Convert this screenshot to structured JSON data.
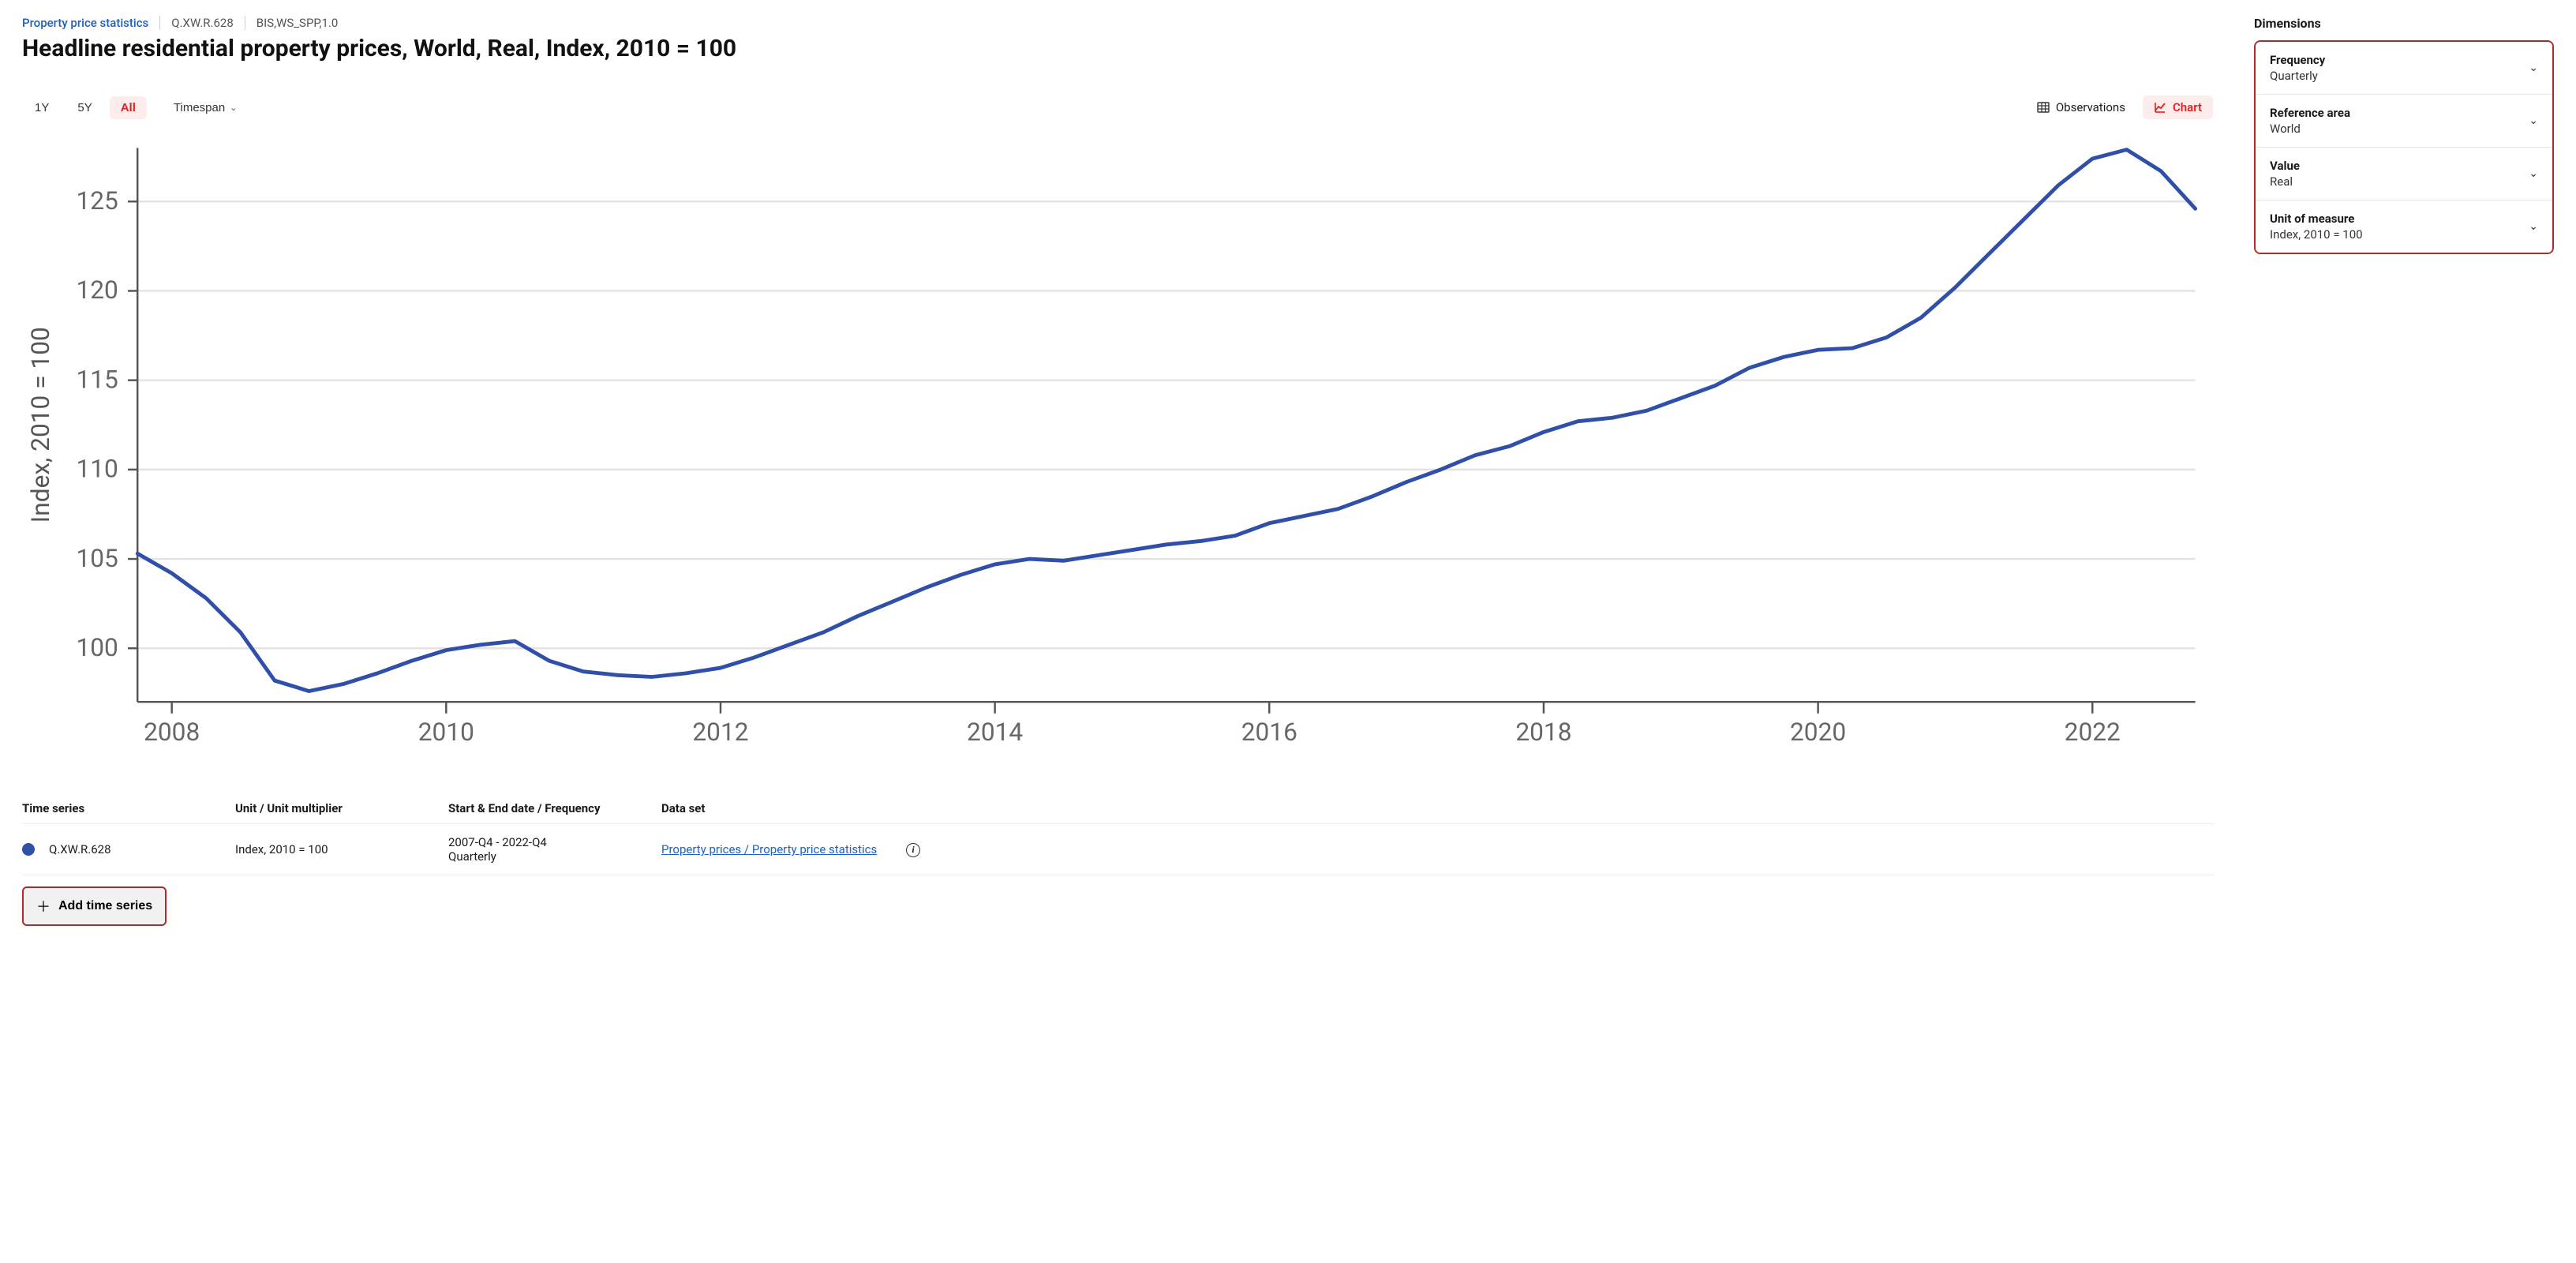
{
  "breadcrumb": {
    "dataset_link": "Property price statistics",
    "series_code": "Q.XW.R.628",
    "source_code": "BIS,WS_SPP,1.0"
  },
  "title": "Headline residential property prices, World, Real, Index, 2010 = 100",
  "controls": {
    "range_1y": "1Y",
    "range_5y": "5Y",
    "range_all": "All",
    "timespan": "Timespan",
    "observations": "Observations",
    "chart": "Chart"
  },
  "chart_data": {
    "type": "line",
    "title": "Headline residential property prices, World, Real, Index, 2010 = 100",
    "xlabel": "",
    "ylabel": "Index, 2010 = 100",
    "ylim": [
      97,
      128
    ],
    "yticks": [
      100,
      105,
      110,
      115,
      120,
      125
    ],
    "x_tick_labels": [
      "2008",
      "2010",
      "2012",
      "2014",
      "2016",
      "2018",
      "2020",
      "2022"
    ],
    "x_tick_values": [
      2008,
      2010,
      2012,
      2014,
      2016,
      2018,
      2020,
      2022
    ],
    "xrange": [
      2007.75,
      2022.75
    ],
    "series": [
      {
        "name": "Q.XW.R.628",
        "color": "#2f4fa8",
        "x": [
          2007.75,
          2008.0,
          2008.25,
          2008.5,
          2008.75,
          2009.0,
          2009.25,
          2009.5,
          2009.75,
          2010.0,
          2010.25,
          2010.5,
          2010.75,
          2011.0,
          2011.25,
          2011.5,
          2011.75,
          2012.0,
          2012.25,
          2012.5,
          2012.75,
          2013.0,
          2013.25,
          2013.5,
          2013.75,
          2014.0,
          2014.25,
          2014.5,
          2014.75,
          2015.0,
          2015.25,
          2015.5,
          2015.75,
          2016.0,
          2016.25,
          2016.5,
          2016.75,
          2017.0,
          2017.25,
          2017.5,
          2017.75,
          2018.0,
          2018.25,
          2018.5,
          2018.75,
          2019.0,
          2019.25,
          2019.5,
          2019.75,
          2020.0,
          2020.25,
          2020.5,
          2020.75,
          2021.0,
          2021.25,
          2021.5,
          2021.75,
          2022.0,
          2022.25,
          2022.5,
          2022.75
        ],
        "values": [
          105.3,
          104.2,
          102.8,
          100.9,
          98.2,
          97.6,
          98.0,
          98.6,
          99.3,
          99.9,
          100.2,
          100.4,
          99.3,
          98.7,
          98.5,
          98.4,
          98.6,
          98.9,
          99.5,
          100.2,
          100.9,
          101.8,
          102.6,
          103.4,
          104.1,
          104.7,
          105.0,
          104.9,
          105.2,
          105.5,
          105.8,
          106.0,
          106.3,
          107.0,
          107.4,
          107.8,
          108.5,
          109.3,
          110.0,
          110.8,
          111.3,
          112.1,
          112.7,
          112.9,
          113.3,
          114.0,
          114.7,
          115.7,
          116.3,
          116.7,
          116.8,
          117.4,
          118.5,
          120.2,
          122.1,
          124.0,
          125.9,
          127.4,
          127.9,
          126.7,
          124.6
        ]
      }
    ]
  },
  "table": {
    "headers": {
      "series": "Time series",
      "unit": "Unit / Unit multiplier",
      "range": "Start & End date / Frequency",
      "dataset": "Data set"
    },
    "rows": [
      {
        "code": "Q.XW.R.628",
        "unit": "Index, 2010 = 100",
        "range_line1": "2007-Q4 - 2022-Q4",
        "range_line2": "Quarterly",
        "dataset": "Property prices / Property price statistics"
      }
    ]
  },
  "add_button": "Add time series",
  "side": {
    "title": "Dimensions",
    "items": [
      {
        "name": "Frequency",
        "value": "Quarterly"
      },
      {
        "name": "Reference area",
        "value": "World"
      },
      {
        "name": "Value",
        "value": "Real"
      },
      {
        "name": "Unit of measure",
        "value": "Index, 2010 = 100"
      }
    ]
  }
}
